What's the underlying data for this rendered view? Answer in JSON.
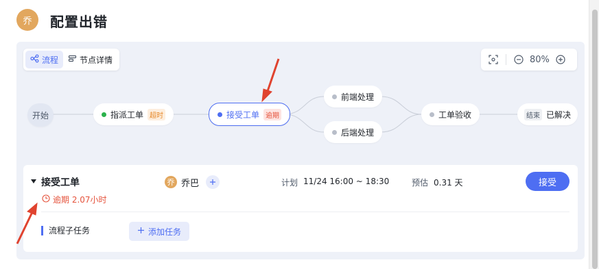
{
  "header": {
    "avatar_text": "乔",
    "title": "配置出错"
  },
  "view_switch": {
    "flow_label": "流程",
    "node_detail_label": "节点详情"
  },
  "zoom": {
    "value": "80%"
  },
  "flow": {
    "start_label": "开始",
    "nodes": [
      {
        "label": "指派工单",
        "tag": "超时",
        "status_color": "#2bb24c"
      },
      {
        "label": "接受工单",
        "tag": "逾期",
        "status_color": "#4e6ef2"
      },
      {
        "label": "前端处理",
        "status_color": "#b8bec9"
      },
      {
        "label": "后端处理",
        "status_color": "#b8bec9"
      },
      {
        "label": "工单验收",
        "status_color": "#b8bec9"
      }
    ],
    "end_tag": "结束",
    "end_label": "已解决"
  },
  "detail": {
    "title": "接受工单",
    "overdue_text": "逾期 2.07小时",
    "assignee_avatar": "乔",
    "assignee_name": "乔巴",
    "plan_label": "计划",
    "plan_value": "11/24 16:00 ~ 18:30",
    "estimate_label": "预估",
    "estimate_value": "0.31 天",
    "accept_button": "接受",
    "subtask_label": "流程子任务",
    "add_task_label": "添加任务"
  },
  "colors": {
    "accent": "#4e6ef2",
    "overdue": "#e5533c",
    "annotation_arrow": "#e0432f"
  }
}
